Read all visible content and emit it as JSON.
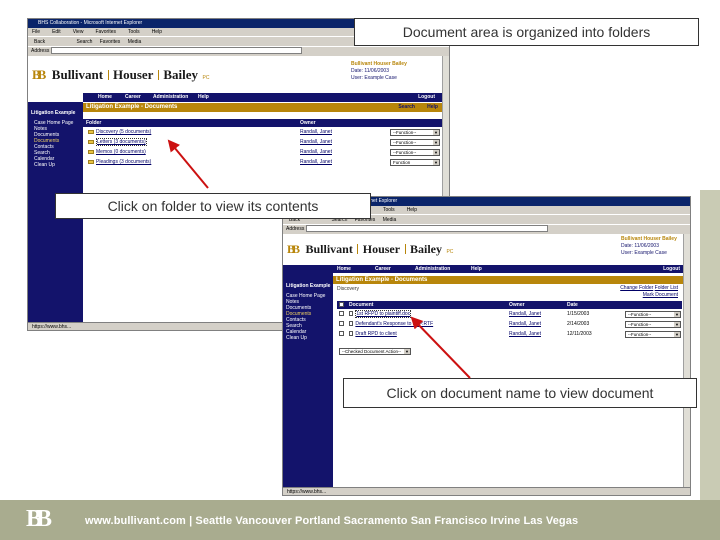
{
  "callouts": {
    "top": "Document area is organized into folders",
    "middle": "Click on folder to view its contents",
    "bottom": "Click on document name to view document"
  },
  "browser": {
    "title": "BHS Collaboration - Microsoft Internet Explorer",
    "menu": [
      "File",
      "Edit",
      "View",
      "Favorites",
      "Tools",
      "Help"
    ],
    "toolbar": [
      "Back",
      "Search",
      "Favorites",
      "Media"
    ],
    "address_label": "Address",
    "status": "https://www.bhs..."
  },
  "firm": {
    "logo_mark": "BB",
    "name_1": "Bullivant",
    "name_2": "Houser",
    "name_3": "Bailey",
    "suffix": "PC",
    "header_title": "Bullivant Houser Bailey",
    "header_date": "Date: 11/06/2003",
    "header_user": "User: Example Case"
  },
  "nav": {
    "items": [
      "Home",
      "Career",
      "Administration",
      "Help"
    ],
    "logout": "Logout"
  },
  "nav2": {
    "items": [
      "Home",
      "Career",
      "Administration",
      "Help"
    ],
    "logout": "Logout"
  },
  "sidebar": {
    "title": "Litigation Example",
    "items": [
      "Case Home Page",
      "Notes",
      "Documents",
      "Documents",
      "Contacts",
      "Search",
      "Calendar",
      "Clean Up"
    ]
  },
  "folders_page": {
    "section_title": "Litigation Example - Documents",
    "search": "Search",
    "help": "Help",
    "col_folder": "Folder",
    "col_owner": "Owner",
    "rows": [
      {
        "name": "Discovery (5 documents)",
        "owner": "Randall, Janet",
        "action": "--Function--"
      },
      {
        "name": "Letters (3 documents)",
        "owner": "Randall, Janet",
        "action": "--Function--"
      },
      {
        "name": "Memos (0 documents)",
        "owner": "Randall, Janet",
        "action": "--Function--"
      },
      {
        "name": "Pleadings (3 documents)",
        "owner": "Randall, Janet",
        "action": "Function"
      }
    ]
  },
  "docs_page": {
    "section_title": "Litigation Example - Documents",
    "breadcrumb": "Discovery",
    "links": [
      "Change Folder",
      "Folder List",
      "Mark Document"
    ],
    "col_document": "Document",
    "col_owner": "Owner",
    "col_date": "Date",
    "rows": [
      {
        "name": "1st RFPD to plaintiff.doc",
        "owner": "Randall, Janet",
        "date": "1/15/2003",
        "action": "--Function--"
      },
      {
        "name": "Defendant's Response to RFP.RTF",
        "owner": "Randall, Janet",
        "date": "2/14/2003",
        "action": "--Function--"
      },
      {
        "name": "Draft RPD to client",
        "owner": "Randall, Janet",
        "date": "12/11/2003",
        "action": "--Function--"
      }
    ],
    "bulk_action": "--Checked Document Action--"
  },
  "footer": {
    "logo_mark": "BB",
    "text": "www.bullivant.com  |  Seattle  Vancouver  Portland  Sacramento  San Francisco  Irvine  Las Vegas"
  },
  "colors": {
    "navy": "#13136b",
    "gold": "#b8860b",
    "footer_bg": "#a9ac8f",
    "arrow": "#cc1111"
  }
}
